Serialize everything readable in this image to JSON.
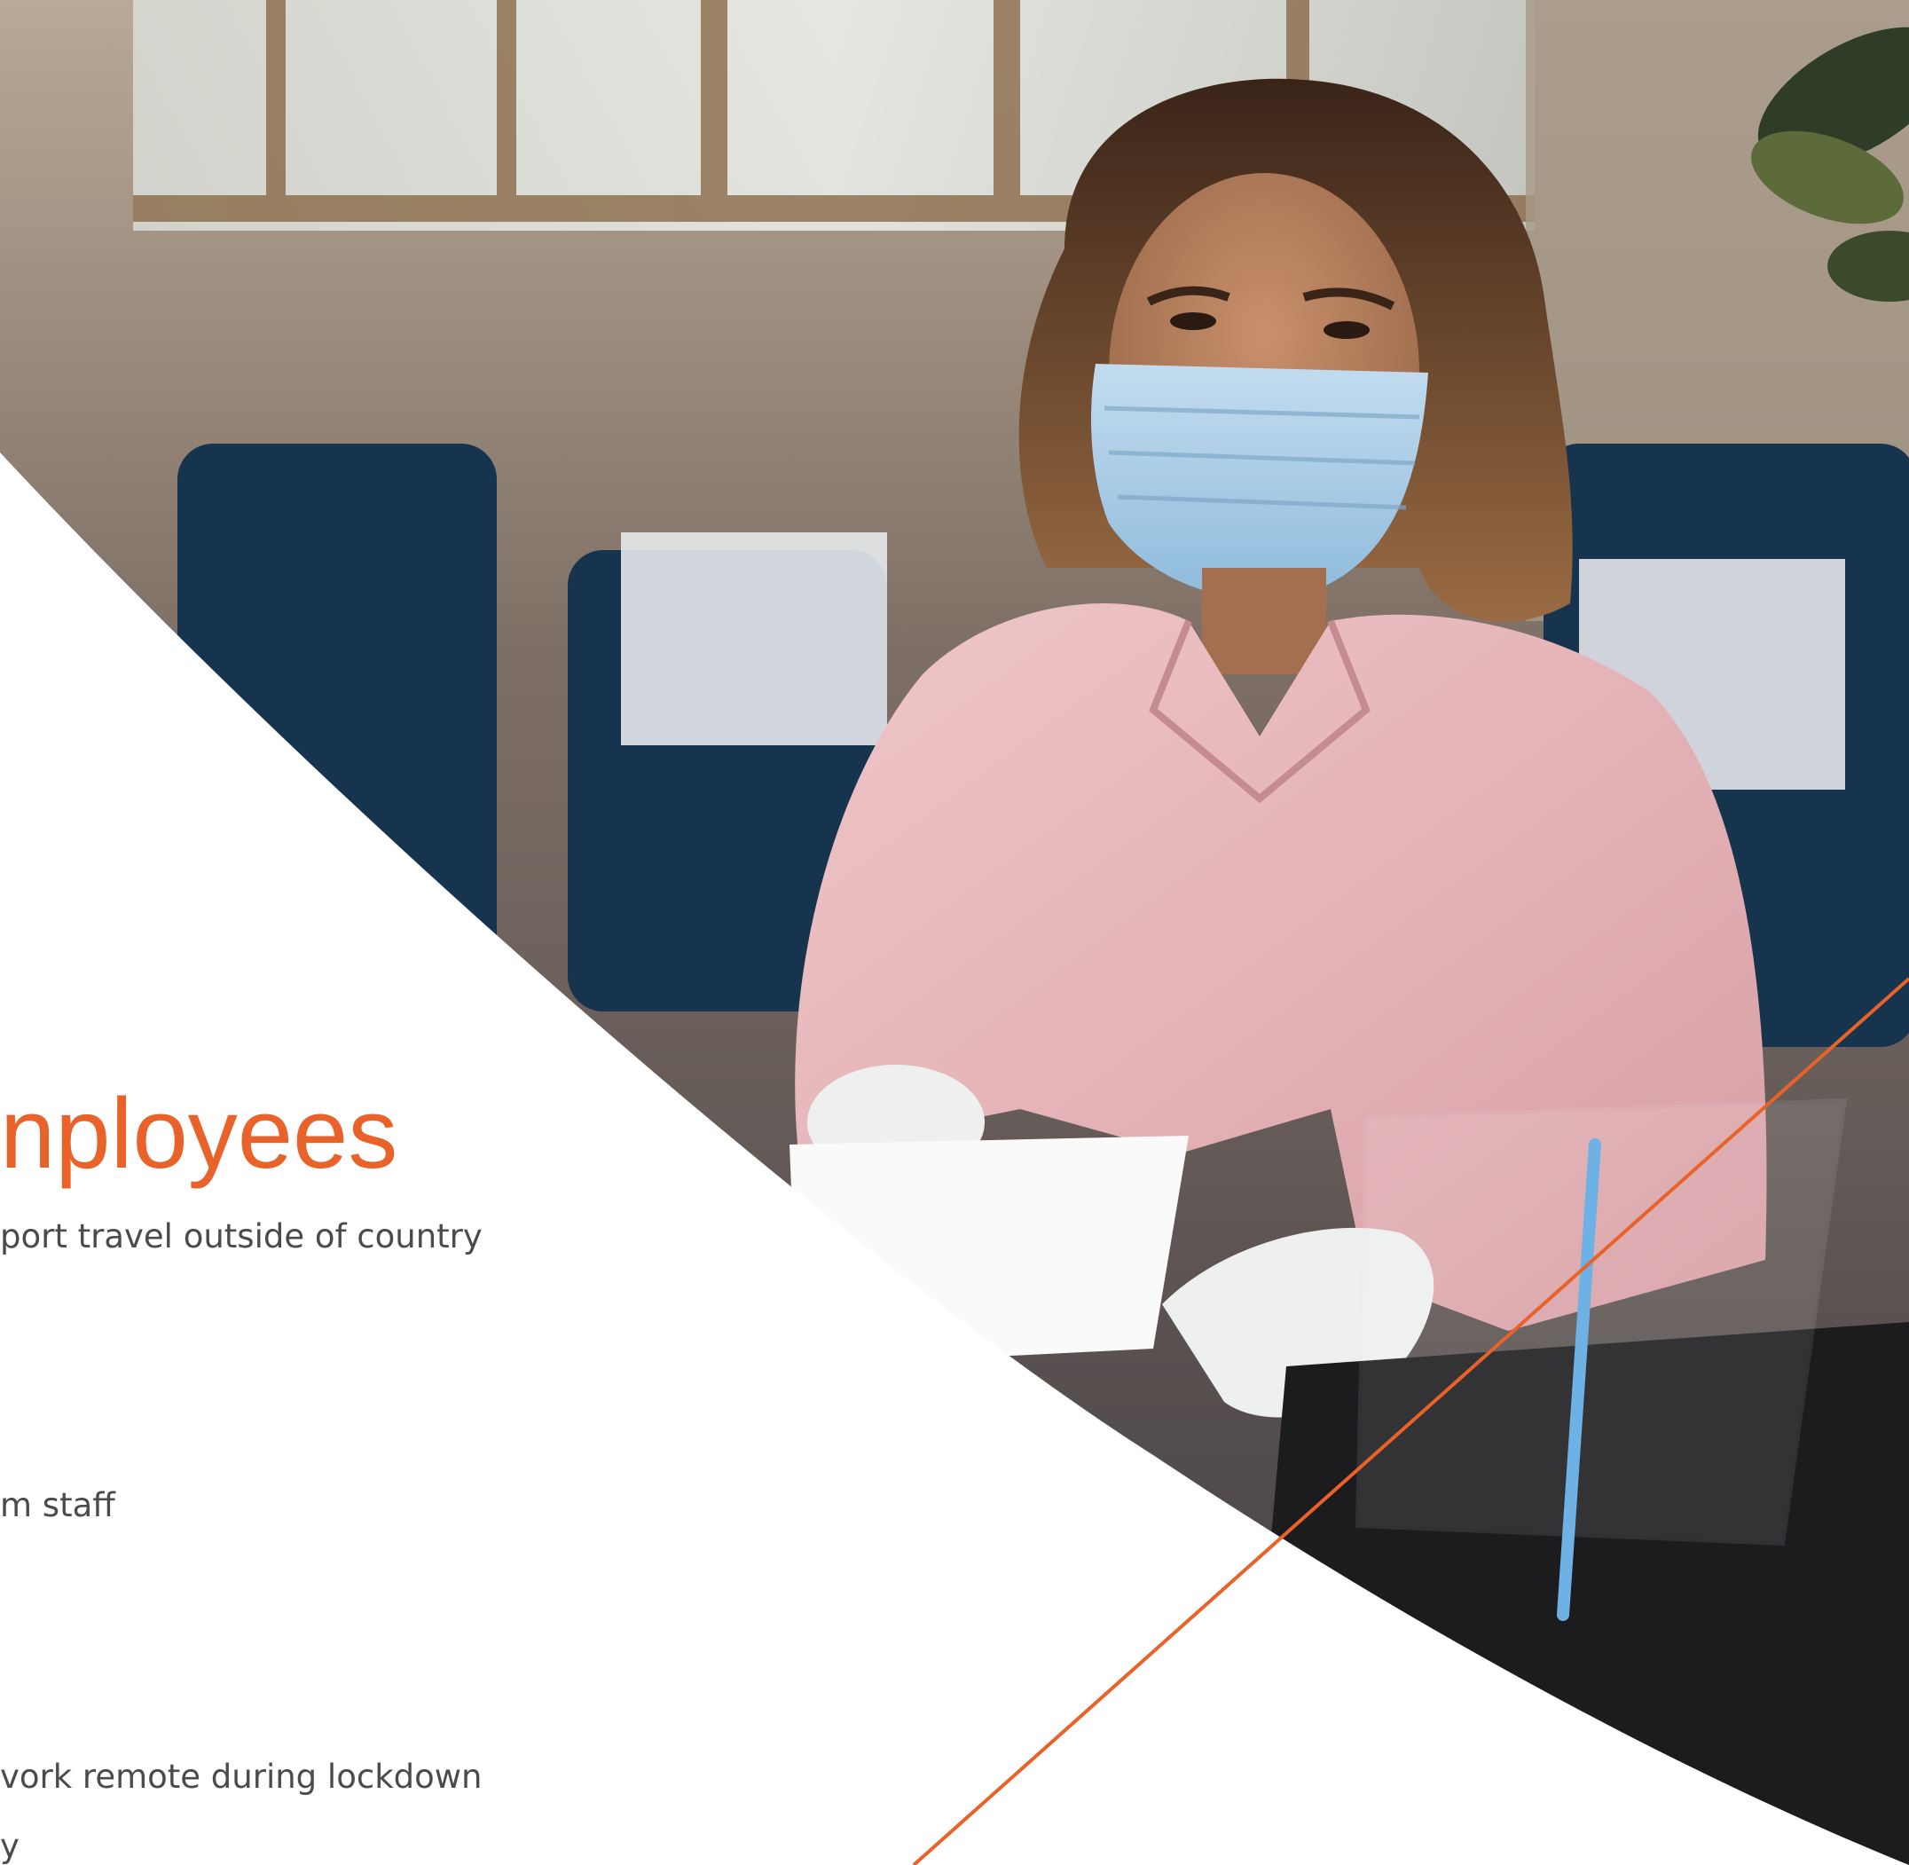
{
  "heading": "nployees",
  "bullet_lines": [
    "port travel outside of country",
    "m staff",
    "vork remote during lockdown",
    "y"
  ],
  "colors": {
    "accent_orange": "#e8622a",
    "body_text": "#4b4b4b",
    "background": "#ffffff",
    "table_dark": "#1c1c1f",
    "shirt_pink": "#e9b9bd",
    "mask_blue": "#a6cce8"
  },
  "photo": {
    "subject": "woman in pink blouse wearing surgical face mask and gloves behind a clear acrylic sneeze guard, handing papers across a desk",
    "icon": "photo-icon"
  }
}
